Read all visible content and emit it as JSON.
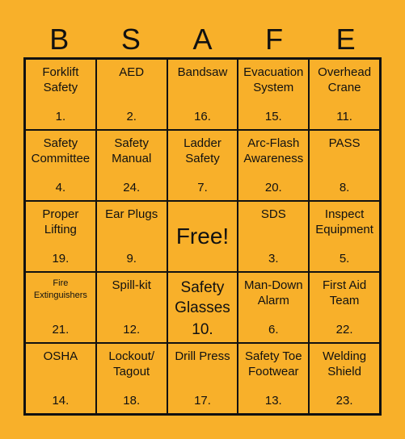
{
  "header": {
    "letters": [
      "B",
      "S",
      "A",
      "F",
      "E"
    ]
  },
  "colors": {
    "background": "#F8B02A",
    "grid": "#111111"
  },
  "cells": [
    {
      "label": "Forklift Safety",
      "num": "1."
    },
    {
      "label": "AED",
      "num": "2."
    },
    {
      "label": "Bandsaw",
      "num": "16."
    },
    {
      "label": "Evacuation System",
      "num": "15."
    },
    {
      "label": "Overhead Crane",
      "num": "11."
    },
    {
      "label": "Safety Committee",
      "num": "4."
    },
    {
      "label": "Safety Manual",
      "num": "24."
    },
    {
      "label": "Ladder Safety",
      "num": "7."
    },
    {
      "label": "Arc-Flash Awareness",
      "num": "20."
    },
    {
      "label": "PASS",
      "num": "8."
    },
    {
      "label": "Proper Lifting",
      "num": "19."
    },
    {
      "label": "Ear Plugs",
      "num": "9."
    },
    {
      "label": "Free!",
      "num": ""
    },
    {
      "label": "SDS",
      "num": "3."
    },
    {
      "label": "Inspect Equipment",
      "num": "5."
    },
    {
      "label": "Fire Extinguishers",
      "num": "21."
    },
    {
      "label": "Spill-kit",
      "num": "12."
    },
    {
      "label": "Safety Glasses",
      "num": "10."
    },
    {
      "label": "Man-Down Alarm",
      "num": "6."
    },
    {
      "label": "First Aid Team",
      "num": "22."
    },
    {
      "label": "OSHA",
      "num": "14."
    },
    {
      "label": "Lockout/ Tagout",
      "num": "18."
    },
    {
      "label": "Drill Press",
      "num": "17."
    },
    {
      "label": "Safety Toe Footwear",
      "num": "13."
    },
    {
      "label": "Welding Shield",
      "num": "23."
    }
  ]
}
